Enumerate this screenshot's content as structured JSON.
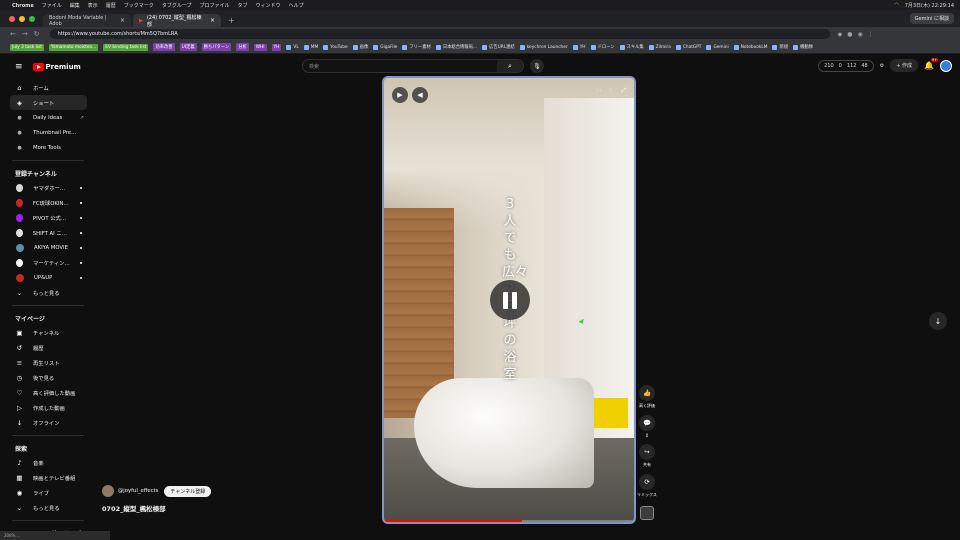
{
  "mac_menu": {
    "items": [
      "Chrome",
      "ファイル",
      "編集",
      "表示",
      "履歴",
      "ブックマーク",
      "タブグループ",
      "プロファイル",
      "タブ",
      "ウィンドウ",
      "ヘルプ"
    ],
    "clock": "7月3日(木) 22:29:14"
  },
  "tabs": [
    {
      "title": "Bodoni Moda Variable | Adob",
      "active": false
    },
    {
      "title": "(24) 0702_縦型_楓松棟部",
      "active": true
    }
  ],
  "gemini_label": "Gemini に相談",
  "url": "https://www.youtube.com/shorts/Mm5Q7bmLRA",
  "bookmarks": [
    "July 3 task list",
    "Yamamoto moiston...",
    "EV binding task list",
    "効率改善",
    "UI定義",
    "勝ちパターン",
    "分析",
    "WHI",
    "YH",
    "VL",
    "MM",
    "YouTube",
    "画像",
    "GigaFile",
    "フリー素材",
    "日本総合情報局...",
    "広告URL連結",
    "keychron Launcher",
    "YH",
    "ドローン",
    "スキル集",
    "Zilmira",
    "ChatGPT",
    "Gemini",
    "NotebookLM",
    "新規",
    "機動隊"
  ],
  "header": {
    "logo_text": "Premium",
    "search_placeholder": "検索",
    "stats": [
      "210",
      "0",
      "112",
      "48"
    ],
    "create_label": "作成",
    "notifications": "9+"
  },
  "sidebar": {
    "main": [
      {
        "icon": "home-icon",
        "glyph": "⌂",
        "label": "ホーム"
      },
      {
        "icon": "shorts-icon",
        "glyph": "◈",
        "label": "ショート"
      },
      {
        "icon": "dot-icon",
        "glyph": "●",
        "label": "Daily Ideas"
      },
      {
        "icon": "dot-icon",
        "glyph": "●",
        "label": "Thumbnail Preview"
      },
      {
        "icon": "dot-icon",
        "glyph": "●",
        "label": "More Tools"
      }
    ],
    "subs_header": "登録チャンネル",
    "subs": [
      {
        "label": "ヤマダホームズ_",
        "color": "#d9d9d9"
      },
      {
        "label": "FC琉球OKINAW...",
        "color": "#c62828"
      },
      {
        "label": "PIVOT 公式チャ...",
        "color": "#a020f0"
      },
      {
        "label": "SHIFT AI ニュース",
        "color": "#e0e0e0"
      },
      {
        "label": "AKIYA MOVIE",
        "color": "#5b8fa8"
      },
      {
        "label": "マーケティング...",
        "color": "#f5f5f5"
      },
      {
        "label": "UP&UP",
        "color": "#c62828"
      }
    ],
    "more_label": "もっと見る",
    "my_header": "マイページ",
    "my": [
      {
        "icon": "channel-icon",
        "glyph": "▣",
        "label": "チャンネル"
      },
      {
        "icon": "history-icon",
        "glyph": "↺",
        "label": "履歴"
      },
      {
        "icon": "playlist-icon",
        "glyph": "≡",
        "label": "再生リスト"
      },
      {
        "icon": "watch-later-icon",
        "glyph": "◷",
        "label": "後で見る"
      },
      {
        "icon": "liked-icon",
        "glyph": "♡",
        "label": "高く評価した動画"
      },
      {
        "icon": "your-videos-icon",
        "glyph": "▷",
        "label": "作成した動画"
      },
      {
        "icon": "offline-icon",
        "glyph": "↓",
        "label": "オフライン"
      }
    ],
    "explore_header": "探索",
    "explore": [
      {
        "icon": "music-icon",
        "glyph": "♪",
        "label": "音楽"
      },
      {
        "icon": "movies-icon",
        "glyph": "▦",
        "label": "映画とテレビ番組"
      },
      {
        "icon": "live-icon",
        "glyph": "◉",
        "label": "ライブ"
      }
    ],
    "explore_more": "もっと見る",
    "services_header": "YouTube の他のサービス"
  },
  "player": {
    "overlay_text": "3人でも広々25坪の浴室",
    "progress_fraction": 0.55
  },
  "actions": {
    "like_label": "高く評価",
    "comments_count": "0",
    "share_label": "共有",
    "remix_label": "リミックス"
  },
  "channel": {
    "handle": "@joyful_effects",
    "subscribe_label": "チャンネル登録",
    "video_title": "0702_縦型_楓松棟部"
  },
  "status_bar": "208% ..."
}
